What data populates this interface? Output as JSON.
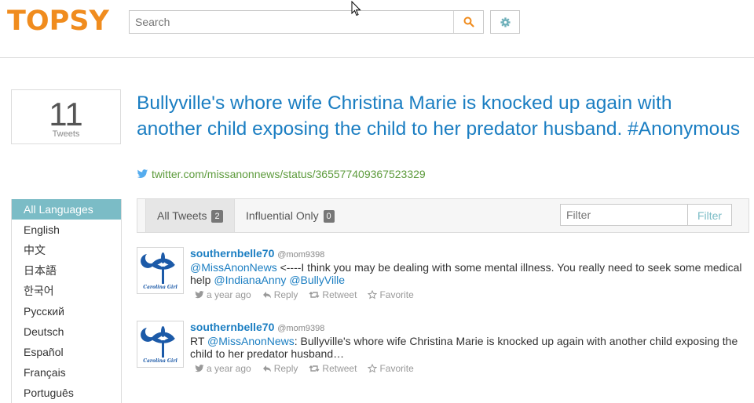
{
  "header": {
    "logo": "TOPSY",
    "search_placeholder": "Search"
  },
  "result": {
    "count": "11",
    "count_label": "Tweets",
    "title": "Bullyville's whore wife Christina Marie is knocked up again with another child exposing the child to her predator husband. #Anonymous",
    "link": "twitter.com/missanonnews/status/365577409367523329"
  },
  "languages": [
    "All Languages",
    "English",
    "中文",
    "日本語",
    "한국어",
    "Русский",
    "Deutsch",
    "Español",
    "Français",
    "Português"
  ],
  "tabs": {
    "all_label": "All Tweets",
    "all_count": "2",
    "influential_label": "Influential Only",
    "influential_count": "0",
    "filter_placeholder": "Filter",
    "filter_button": "Filter"
  },
  "tweets": [
    {
      "author": "southernbelle70",
      "handle": "@mom9398",
      "m1": "@MissAnonNews",
      "t1": " <----I think you may be dealing with some mental illness. You really need to seek some medical help ",
      "m2": "@IndianaAnny",
      "m3": "@BullyVille",
      "time": "a year ago",
      "reply": "Reply",
      "retweet": "Retweet",
      "favorite": "Favorite"
    },
    {
      "author": "southernbelle70",
      "handle": "@mom9398",
      "prefix": "RT ",
      "m1": "@MissAnonNews",
      "t1": ": Bullyville's whore wife Christina Marie is knocked up again with another child exposing the child to her predator husband…",
      "time": "a year ago",
      "reply": "Reply",
      "retweet": "Retweet",
      "favorite": "Favorite"
    }
  ],
  "avatar_caption": "Carolina Girl",
  "colors": {
    "brand": "#f08c1e",
    "link": "#1b7ec2",
    "accent": "#7bbcc6",
    "url": "#5d9b3c"
  }
}
